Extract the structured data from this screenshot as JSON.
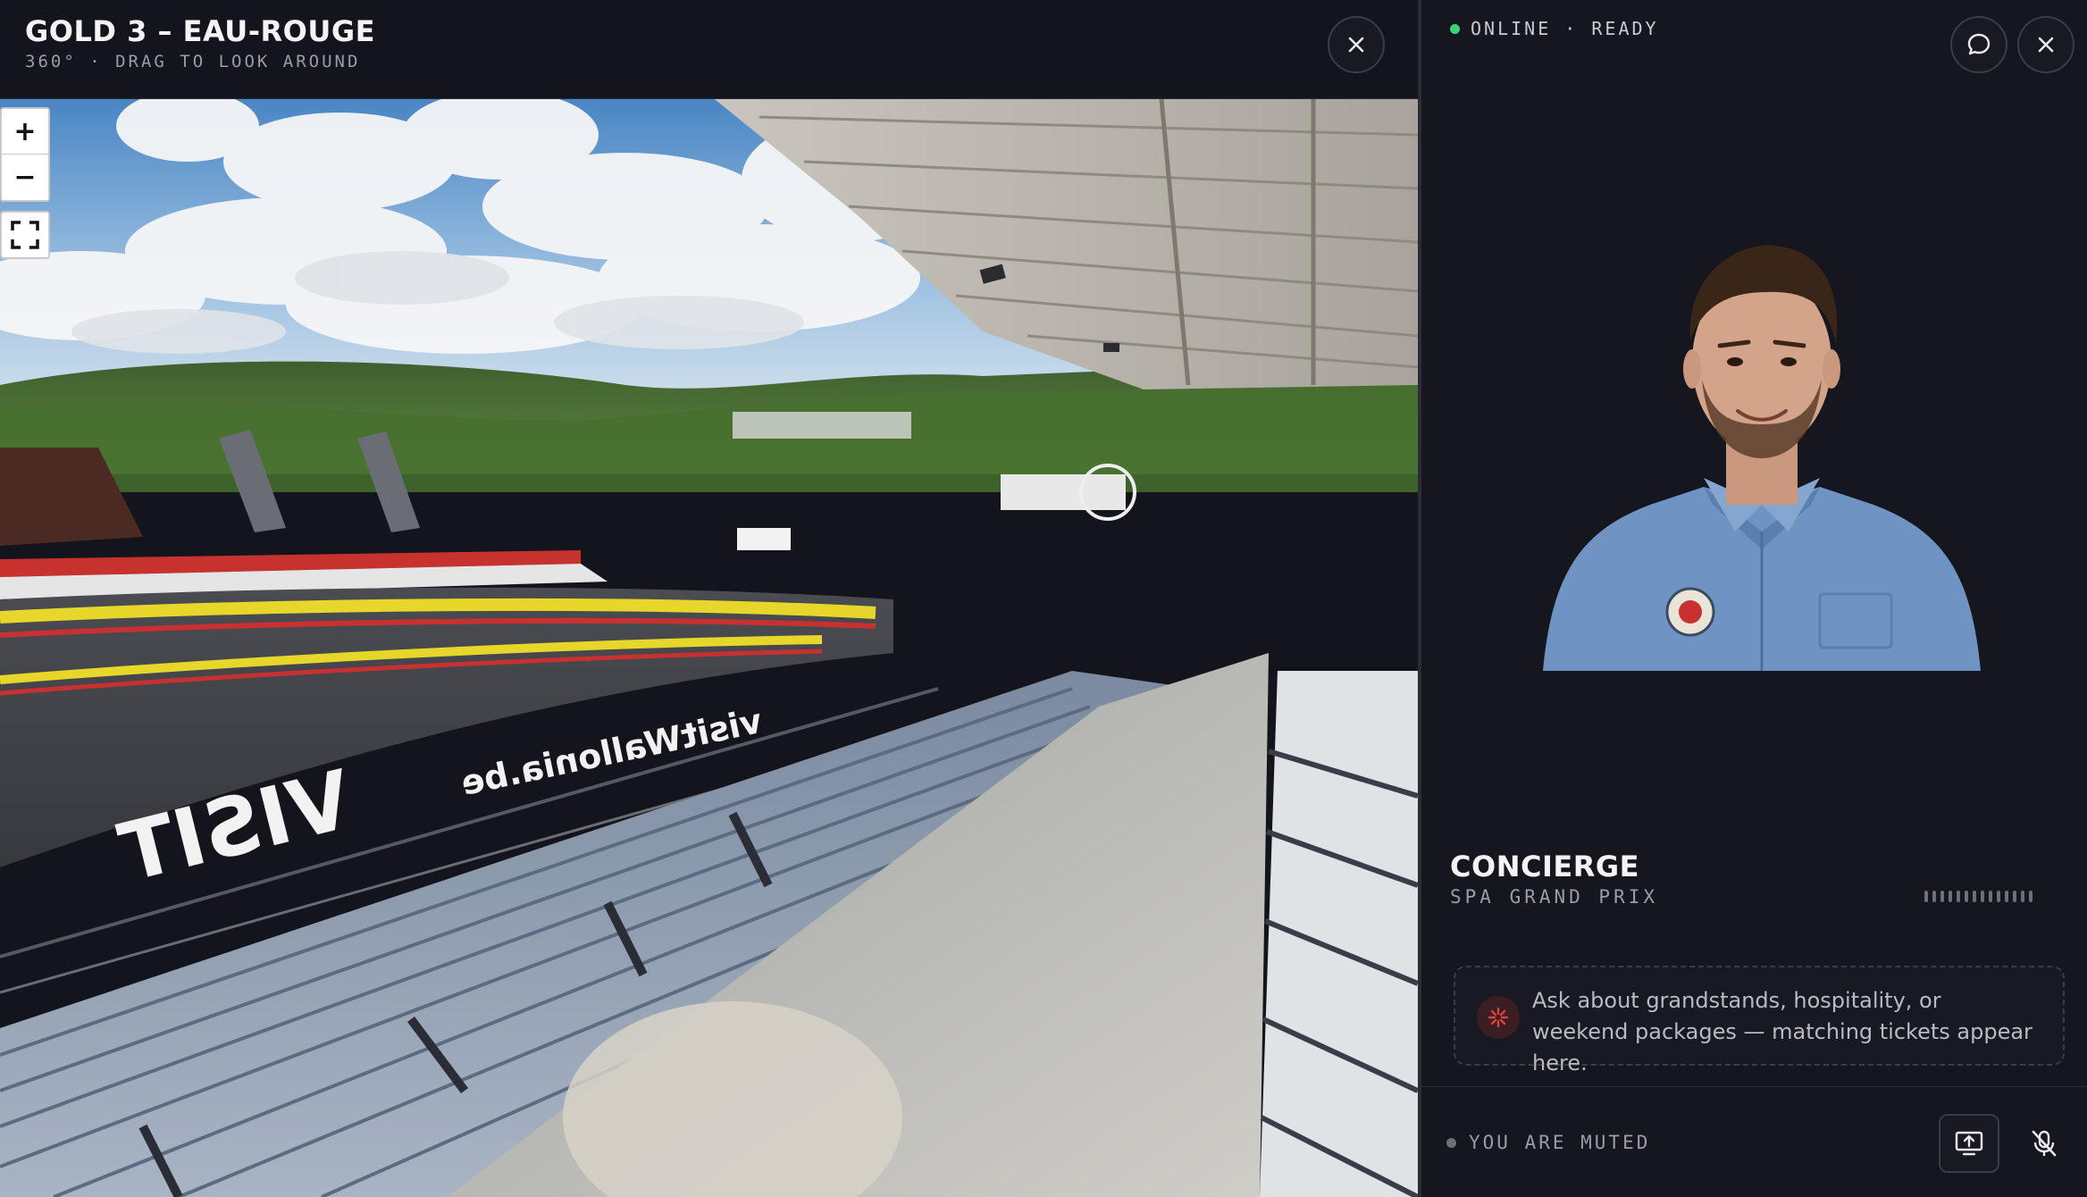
{
  "viewer": {
    "title": "GOLD 3 – EAU-ROUGE",
    "subtitle": "360° · DRAG TO LOOK AROUND",
    "zoom_in_label": "+",
    "zoom_out_label": "−",
    "panorama_signage": "VISIT",
    "panorama_signage_2": "visitWallonia.be"
  },
  "side": {
    "status_text": "ONLINE · READY",
    "agent_name": "CONCIERGE",
    "agent_subtitle": "SPA GRAND PRIX",
    "hint_text": "Ask about grandstands, hospitality, or weekend packages — matching tickets appear here.",
    "muted_text": "YOU ARE MUTED"
  },
  "colors": {
    "background": "#13141c",
    "panel": "#15161e",
    "status_online": "#3ecf7a",
    "accent_red": "#e0403a"
  },
  "icons": [
    "close-icon",
    "chat-icon",
    "fullscreen-icon",
    "spark-icon",
    "screen-share-icon",
    "mic-off-icon"
  ]
}
